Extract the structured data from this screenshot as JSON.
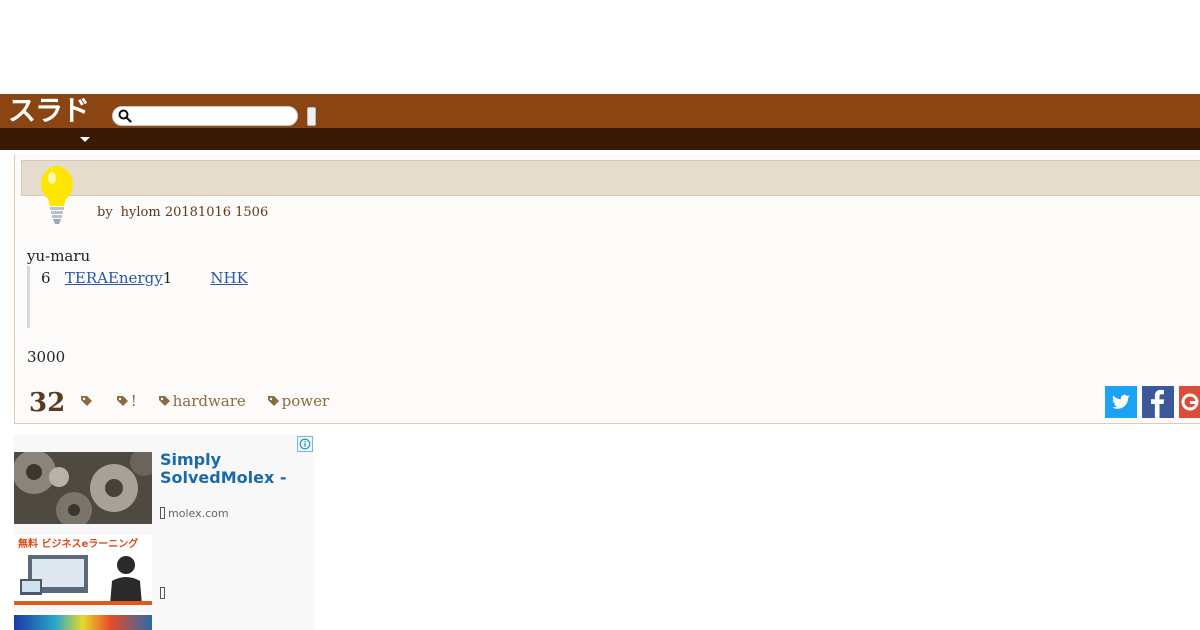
{
  "header": {
    "logo": "スラド",
    "search_placeholder": ""
  },
  "article": {
    "byline_prefix": "by",
    "author": "hylom",
    "timestamp": "20181016 1506",
    "submitter": "yu-maru",
    "quote": {
      "number": "6",
      "link1": "TERAEnergy",
      "after_link1": "1",
      "link2": "NHK"
    },
    "body": "3000",
    "comment_count": "32",
    "tags": [
      "",
      "!",
      "hardware",
      "power"
    ]
  },
  "ad": {
    "headline": "Simply SolvedMolex -",
    "domain": "molex.com",
    "thumb2_caption": "無料 ビジネスeラーニング",
    "domain2": ""
  },
  "colors": {
    "header_brown": "#8b4513",
    "subnav_dark": "#3a1a05",
    "title_bar": "#e6dcce",
    "link_blue": "#2a55a8",
    "tag_color": "#8a6a42"
  },
  "icons": [
    "search-icon",
    "chevron-down-icon",
    "lightbulb-icon",
    "tag-icon",
    "twitter-icon",
    "facebook-icon",
    "google-plus-icon",
    "info-icon"
  ]
}
